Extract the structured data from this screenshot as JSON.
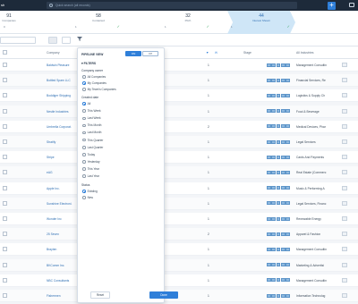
{
  "app": {
    "title": "sh"
  },
  "search": {
    "placeholder": "Quick search (all records)"
  },
  "stages": [
    {
      "num": "91",
      "label": "Companies",
      "count": "0"
    },
    {
      "num": "58",
      "label": "Contacted",
      "count": "1"
    },
    {
      "num": "32",
      "label": "Pitch",
      "count": "1"
    },
    {
      "num": "44",
      "label": "Interest Shown",
      "count": "1"
    }
  ],
  "columns": {
    "company": "Company",
    "stage": "Stage",
    "industries": "All Industries"
  },
  "rows": [
    {
      "company": "Baldwin Pleasure",
      "num": "1",
      "industry": "Management Consultin"
    },
    {
      "company": "Bottled Spam LLC",
      "num": "1",
      "industry": "Financial Services, Re"
    },
    {
      "company": "Boddiger Shipping",
      "num": "1",
      "industry": "Logistics & Supply Ch"
    },
    {
      "company": "Nestle Industries",
      "num": "1",
      "industry": "Food & Beverage"
    },
    {
      "company": "Umbrella Corporat.",
      "num": "2",
      "industry": "Medical Devices, Phar"
    },
    {
      "company": "Stratify",
      "num": "1",
      "industry": "Legal Services"
    },
    {
      "company": "Stripe",
      "num": "1",
      "industry": "Cards And Payments"
    },
    {
      "company": "eAG",
      "num": "1",
      "industry": "Real Estate (Commerc"
    },
    {
      "company": "Apple Inc.",
      "num": "1",
      "industry": "Music & Performing A"
    },
    {
      "company": "Sunshine Electroni.",
      "num": "1",
      "industry": "Legal Services, Financ"
    },
    {
      "company": "Wonder Inc",
      "num": "1",
      "industry": "Renewable Energy"
    },
    {
      "company": "25 Seven",
      "num": "2",
      "industry": "Apparel & Fashion"
    },
    {
      "company": "Brayten",
      "num": "1",
      "industry": "Management Consultin"
    },
    {
      "company": "BKComm Inc.",
      "num": "1",
      "industry": "Marketing & Advertisi"
    },
    {
      "company": "NBC Consultants",
      "num": "1",
      "industry": "Management Consultin"
    },
    {
      "company": "Fishermen",
      "num": "1",
      "industry": "Information Technolog"
    }
  ],
  "panel": {
    "pipeline_view": "PIPELINE VIEW",
    "on": "ON",
    "off": "Off",
    "filters": "FILTERS",
    "company_owner_title": "Company owner",
    "owner_options": [
      "All Companies",
      "My Companies",
      "My Team's Companies"
    ],
    "created_date_title": "Created date",
    "date_options": [
      "All",
      "This Week",
      "Last Week",
      "This Month",
      "Last Month",
      "This Quarter",
      "Last Quarter",
      "Today",
      "Yesterday",
      "This Year",
      "Last Year"
    ],
    "status_title": "Status",
    "status_options": [
      "Existing",
      "New"
    ],
    "reset": "Reset",
    "done": "Done"
  }
}
